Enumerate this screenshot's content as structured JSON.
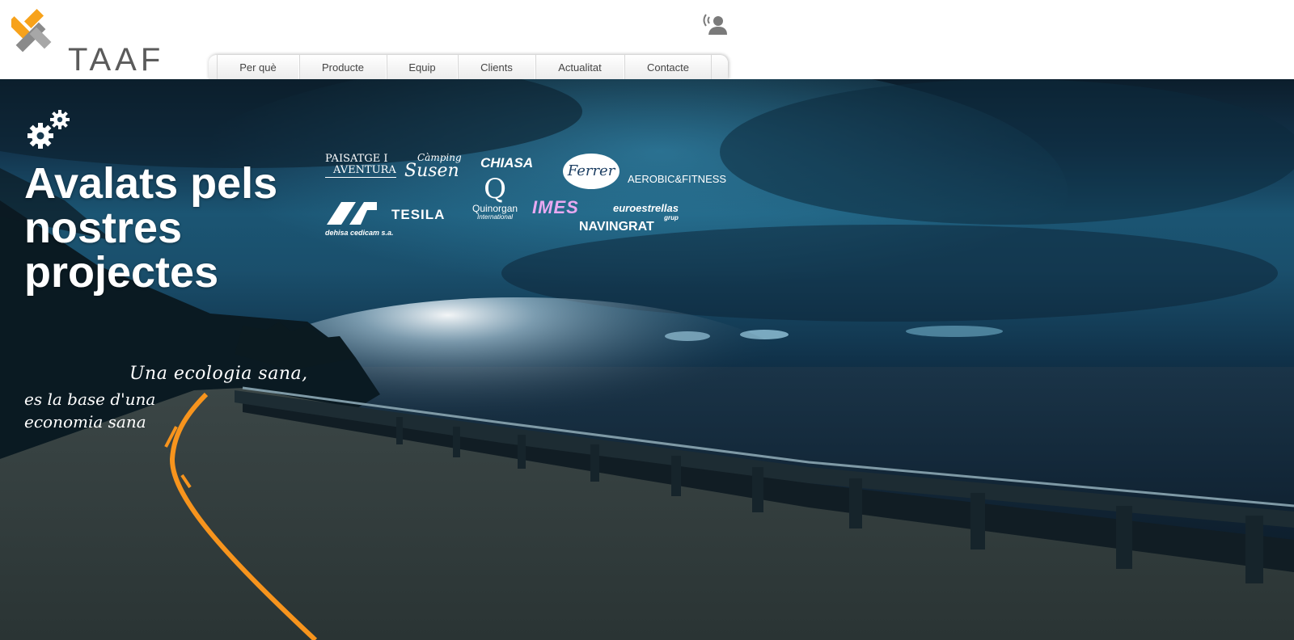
{
  "brand": {
    "name": "TAAF",
    "colors": {
      "accent": "#f7a21b",
      "logo_gray": "#5b5b5b",
      "road_line": "#f7941d"
    }
  },
  "header": {
    "contact_icon": "contact-signal-icon",
    "nav": [
      {
        "label": "Per què"
      },
      {
        "label": "Producte"
      },
      {
        "label": "Equip"
      },
      {
        "label": "Clients"
      },
      {
        "label": "Actualitat"
      },
      {
        "label": "Contacte"
      }
    ]
  },
  "hero": {
    "icon": "gears-icon",
    "title": "Avalats pels nostres projectes",
    "slogan_line1": "Una ecologia sana,",
    "slogan_line2": "es la base d'una economia sana"
  },
  "clients": {
    "paisatge_line1": "PAISATGE I",
    "paisatge_line2": "AVENTURA",
    "camping_small": "Càmping",
    "camping_big": "Susen",
    "chiasa": "CHIASA",
    "ferrer": "Ferrer",
    "aerobic": "AEROBIC&FITNESS",
    "dehisa": "dehisa cedicam s.a.",
    "tesila": "TESILA",
    "quinorgan": "Quinorgan",
    "quinorgan_sub": "International",
    "imes": "IMES",
    "euroestrellas": "euroestrellas",
    "euroestrellas_sub": "grup",
    "navingrat": "NAVINGRAT"
  }
}
